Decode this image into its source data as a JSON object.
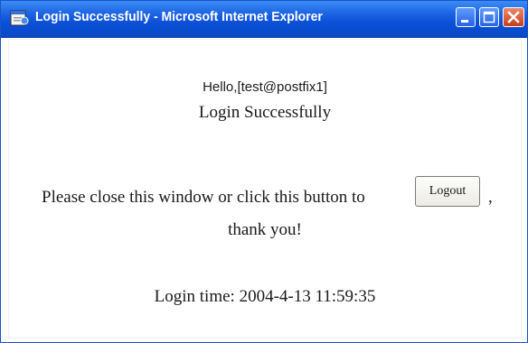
{
  "window": {
    "title": "Login Successfully - Microsoft Internet Explorer",
    "icons": [
      "ie-page-icon",
      "minimize-icon",
      "maximize-icon",
      "close-icon"
    ],
    "colors": {
      "titlebar": "#0b50d8",
      "close_button": "#c63f18",
      "background": "#ffffff"
    }
  },
  "page": {
    "greeting": "Hello,[test@postfix1]",
    "success_message": "Login Successfully",
    "instruction": "Please close this window or click this button to",
    "logout_label": "Logout",
    "comma": ",",
    "thanks": "thank you!",
    "login_time_label": "Login time: ",
    "login_time_value": "2004-4-13 11:59:35"
  }
}
